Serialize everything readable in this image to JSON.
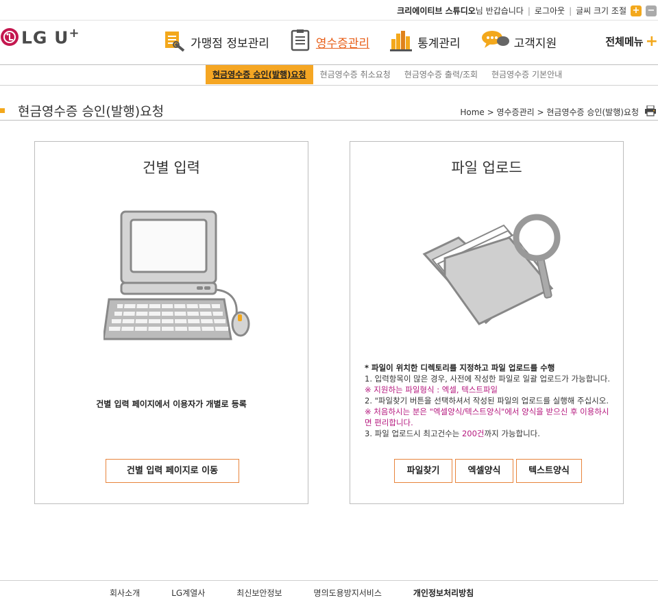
{
  "topbar": {
    "user": "크리에이티브 스튜디오",
    "greeting": "님 반갑습니다",
    "logout": "로그아웃",
    "font_size_label": "글씨 크기 조절",
    "font_plus": "+",
    "font_minus": "−"
  },
  "logo": {
    "text": "LG U",
    "sup": "+"
  },
  "gnb": [
    {
      "label": "가맹점 정보관리",
      "icon": "store-doc-icon",
      "active": false
    },
    {
      "label": "영수증관리",
      "icon": "receipt-icon",
      "active": true
    },
    {
      "label": "통계관리",
      "icon": "bar-chart-icon",
      "active": false
    },
    {
      "label": "고객지원",
      "icon": "speech-bubble-icon",
      "active": false
    }
  ],
  "allmenu": {
    "label": "전체메뉴",
    "plus": "+"
  },
  "subnav": [
    {
      "label": "현금영수증 승인(발행)요청",
      "active": true
    },
    {
      "label": "현금영수증 취소요청",
      "active": false
    },
    {
      "label": "현금영수증 출력/조회",
      "active": false
    },
    {
      "label": "현금영수증 기본안내",
      "active": false
    }
  ],
  "page": {
    "title": "현금영수증 승인(발행)요청",
    "breadcrumb": [
      "Home",
      "영수증관리",
      "현금영수증 승인(발행)요청"
    ]
  },
  "left_panel": {
    "title": "건별 입력",
    "description": "건별 입력 페이지에서 이용자가 개별로 등록",
    "button": "건별 입력 페이지로 이동"
  },
  "right_panel": {
    "title": "파일 업로드",
    "head": "* 파일이 위치한 디렉토리를 지정하고 파일 업로드를 수행",
    "line1a": "1. 입력항목이 많은 경우, 사전에 작성한 파일로 일괄 업로드가 가능합니다.",
    "line1b": "※ 지원하는 파일형식 : 엑셀, 텍스트파일",
    "line2a": "2. \"파일찾기 버튼을 선택하셔서 작성된 파일의 업로드를 실행해 주십시오.",
    "line2b": "※ 처음하시는 분은 \"엑셀양식/텍스트양식\"에서 양식을 받으신 후 이용하시면 편리합니다.",
    "line3a": "3. 파일 업로드시 최고건수는 ",
    "line3b": "200건",
    "line3c": "까지 가능합니다.",
    "buttons": [
      "파일찾기",
      "엑셀양식",
      "텍스트양식"
    ]
  },
  "footer": [
    "회사소개",
    "LG계열사",
    "최신보안정보",
    "명의도용방지서비스",
    "개인정보처리방침"
  ],
  "colors": {
    "accent": "#f5a623",
    "active_link": "#e8601a",
    "notice": "#b5187e",
    "button_border": "#e8833a"
  }
}
